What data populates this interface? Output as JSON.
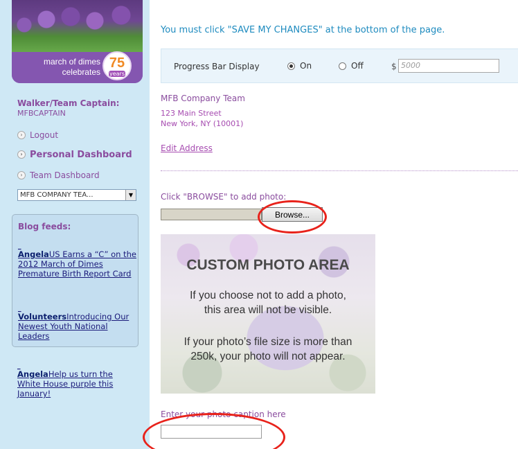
{
  "sidebar": {
    "banner": {
      "tagline": "march of dimes celebrates",
      "badge_number": "75",
      "badge_suffix": "years"
    },
    "captain_label": "Walker/Team Captain:",
    "captain_id": "MFBCAPTAIN",
    "links": {
      "logout": "Logout",
      "personal_dashboard": "Personal Dashboard",
      "team_dashboard": "Team Dashboard"
    },
    "team_select_value": "MFB COMPANY TEA...",
    "blog": {
      "title": "Blog feeds:",
      "entries": [
        {
          "author": "Angela",
          "text": "US Earns a “C” on the 2012 March of Dimes Premature Birth Report Card"
        },
        {
          "author": "Volunteers",
          "text": "Introducing Our Newest Youth National Leaders"
        },
        {
          "author": "Angela",
          "text": "Help us turn the White House purple this January!"
        }
      ]
    }
  },
  "main": {
    "notice": "You must click \"SAVE MY CHANGES\" at the bottom of the page.",
    "progress": {
      "label": "Progress Bar Display",
      "on_label": "On",
      "off_label": "Off",
      "selected": "On",
      "currency": "$",
      "amount_placeholder": "5000"
    },
    "team_name": "MFB Company Team",
    "address_line1": "123 Main Street",
    "address_line2": "New York, NY (10001)",
    "edit_address": "Edit Address",
    "browse_hint": "Click \"BROWSE\" to add photo:",
    "browse_button": "Browse...",
    "photo_area": {
      "title": "CUSTOM PHOTO AREA",
      "line1": "If you choose not to add a photo,",
      "line2": "this area will not be visible.",
      "line3": "If your photo’s file size is more than",
      "line4": "250k, your photo will not appear."
    },
    "caption_label": "Enter your photo caption here"
  },
  "colors": {
    "sidebar_bg": "#cfe8f5",
    "purple_text": "#8a4c9e",
    "notice_blue": "#1e8bbf",
    "highlight_red": "#e8221b"
  }
}
